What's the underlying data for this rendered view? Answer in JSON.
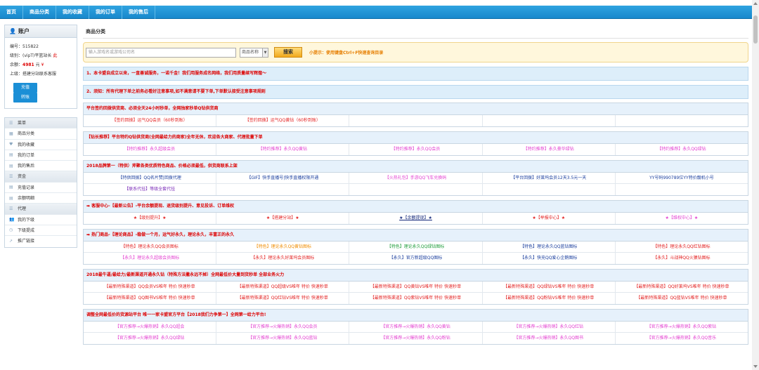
{
  "topnav": [
    "首页",
    "商品分类",
    "我的收藏",
    "我的订单",
    "我的售后"
  ],
  "account": {
    "title": "账户",
    "id_label": "编号：",
    "id": "515822",
    "level_label": "级别：",
    "level": "(vipT)平篮站长",
    "level_badge": "此",
    "balance_label": "余额：",
    "balance": "4981",
    "balance_unit": "元",
    "balance_icon": "¥",
    "parent_label": "上级：",
    "parent": "搭建分站联系客服",
    "recharge": "充值",
    "transfer": "转账"
  },
  "menu": [
    {
      "label": "菜单",
      "group": true
    },
    {
      "label": "商品分类",
      "group": false
    },
    {
      "label": "我的收藏",
      "group": false
    },
    {
      "label": "我的订单",
      "group": false
    },
    {
      "label": "我的售后",
      "group": false
    },
    {
      "label": "资金",
      "group": true
    },
    {
      "label": "充值记录",
      "group": false
    },
    {
      "label": "余额明细",
      "group": false
    },
    {
      "label": "代理",
      "group": true
    },
    {
      "label": "我的下级",
      "group": false
    },
    {
      "label": "下级提成",
      "group": false
    },
    {
      "label": "推广链接",
      "group": false
    }
  ],
  "main": {
    "title": "商品分类",
    "search_placeholder": "输入游戏名或游戏公司名",
    "search_select": "商品名称",
    "search_button": "搜索",
    "search_tip": "小提示：使用键盘Ctrl+F快速查询目录",
    "notice1": "1、本卡盟自成立以来，一直善诚服务，一诺千金！我们用服务成名网络，我们用质量续写辉煌～",
    "notice2": "2、须知：所有代理下单之前务必看好注意事项,如不满意请不要下单,下单默认接受注意事项规则"
  },
  "sections": [
    {
      "head": "平台签约回拨供货商、必须全天24小时秒单，全网独家秒单Q钻供货商",
      "rows": [
        [
          {
            "t": "【签约回拨】运气QQ会员（60秒到账）",
            "c": "c-red"
          },
          {
            "t": "【签约回拨】运气QQ黄钻（60秒到账）",
            "c": "c-red"
          },
          {
            "t": "",
            "c": ""
          },
          {
            "t": "",
            "c": ""
          },
          {
            "t": "",
            "c": ""
          }
        ]
      ]
    },
    {
      "head": "【钻长推荐】平台特约Q钻供货商(全网最给力的商家)全年无休，欢迎各大商家、代理批量下单",
      "rows": [
        [
          {
            "t": "【特约推荐】永久超级会员",
            "c": "c-pink"
          },
          {
            "t": "【特约推荐】永久QQ黄钻",
            "c": "c-pink"
          },
          {
            "t": "【特约推荐】永久QQ会员",
            "c": "c-pink"
          },
          {
            "t": "【特约推荐】永久豪华绿钻",
            "c": "c-pink"
          },
          {
            "t": "【特约推荐】永久QQ绿钻",
            "c": "c-pink"
          }
        ]
      ]
    },
    {
      "head": "2018品牌第一（特供）斧聚各类优质特色商品、价格必须最低，供货商联系上架",
      "rows": [
        [
          {
            "t": "【特供回拨】QQ名片赞|回拨代理",
            "c": "c-blue"
          },
          {
            "t": "【GIF】快手直播号|快手直播权限开通",
            "c": "c-blue"
          },
          {
            "t": "【火热礼包】手游QQ飞车兑换码",
            "c": "c-pink"
          },
          {
            "t": "【平台回拨】好莱坞会员12天3.5元一天",
            "c": "c-blue"
          },
          {
            "t": "YY号码990789位YY特价靓机小号",
            "c": "c-blue"
          }
        ],
        [
          {
            "t": "【联系代挂】等级全套代挂",
            "c": "c-purple"
          },
          {
            "t": "",
            "c": ""
          },
          {
            "t": "",
            "c": ""
          },
          {
            "t": "",
            "c": ""
          },
          {
            "t": "",
            "c": ""
          }
        ]
      ]
    },
    {
      "head": "➡ 客服中心-【最新公告】-平台余额提现、退货级别提升、意见投诉、订单维权",
      "rows": [
        [
          {
            "t": "★【级别提升】★",
            "c": "c-red"
          },
          {
            "t": "★【搭建分站】★",
            "c": "c-red"
          },
          {
            "t": "★【余额提现】★",
            "c": "c-navy u"
          },
          {
            "t": "★【举报中心】★",
            "c": "c-red"
          },
          {
            "t": "★【维权中心】★",
            "c": "c-pink"
          }
        ]
      ]
    },
    {
      "head": "➡ 热门商品-【理论商品】-稳做一个月，运气好永久，理论永久，丰富正的永久",
      "rows": [
        [
          {
            "t": "【特色】理论永久QQ会员图标",
            "c": "c-red"
          },
          {
            "t": "【特色】理论永久QQ黄钻图标",
            "c": "c-orange"
          },
          {
            "t": "【特色】理论永久QQ绿钻图标",
            "c": "c-green"
          },
          {
            "t": "【特色】理论永久QQ蓝钻图标",
            "c": "c-blue"
          },
          {
            "t": "【特色】理论永久QQ红钻图标",
            "c": "c-red"
          }
        ],
        [
          {
            "t": "【永久】理论永久超级会员图标",
            "c": "c-pink"
          },
          {
            "t": "【永久】理论永久好莱坞会员图标",
            "c": "c-red"
          },
          {
            "t": "【永久】官方新超级QQ图标",
            "c": "c-blue"
          },
          {
            "t": "【永久】快充QQ爱心企鹅图标",
            "c": "c-blue"
          },
          {
            "t": "【永久】斗战神QQ火猿钻图标",
            "c": "c-red"
          }
        ]
      ]
    },
    {
      "head": "2018最牛逼/最给力/最新渠道开通永久钻（特殊方法撇永远不掉）全网最低价大量到货秒单 全部业务火力",
      "rows": [
        [
          {
            "t": "【最新特殊渠道】QQ会员VS唯年 特价 快速秒单",
            "c": "c-red"
          },
          {
            "t": "【最新特殊渠道】QQ超级VS唯年 特价 快速秒单",
            "c": "c-red"
          },
          {
            "t": "【最新特殊渠道】QQ黄钻VS唯年 特价 快速秒单",
            "c": "c-red"
          },
          {
            "t": "【最新特殊渠道】QQ绿钻VS唯年 特价 快速秒单",
            "c": "c-red"
          },
          {
            "t": "【最新特殊渠道】QQ好莱坞VS唯年 特价 快速秒单",
            "c": "c-red"
          }
        ],
        [
          {
            "t": "【最新特殊渠道】QQ图书VS唯年 特价 快速秒单",
            "c": "c-red"
          },
          {
            "t": "【最新特殊渠道】QQ红钻VS唯年 特价 快速秒单",
            "c": "c-red"
          },
          {
            "t": "【最新特殊渠道】QQ紫钻VS唯年 特价 快速秒单",
            "c": "c-red"
          },
          {
            "t": "【最新特殊渠道】QQ粉钻VS唯年 特价 快速秒单",
            "c": "c-red"
          },
          {
            "t": "【最新特殊渠道】QQ蓝钻VS唯年 特价 快速秒单",
            "c": "c-red"
          }
        ]
      ]
    },
    {
      "head": "调整全网最低价的货源站平台 唯一一家卡盟官方平台【2018我们力争第一】全网第一给力平台!",
      "rows": [
        [
          {
            "t": "【官方推荐→火爆热销】永久QQ超会",
            "c": "c-pink"
          },
          {
            "t": "【官方推荐→火爆热销】永久QQ会员",
            "c": "c-pink"
          },
          {
            "t": "【官方推荐→火爆热销】永久QQ黄钻",
            "c": "c-pink"
          },
          {
            "t": "【官方推荐→火爆热销】永久QQ红钻",
            "c": "c-pink"
          },
          {
            "t": "【官方推荐→火爆热销】永久QQ紫钻",
            "c": "c-pink"
          }
        ],
        [
          {
            "t": "【官方推荐→火爆热销】永久QQ绿钻",
            "c": "c-pink"
          },
          {
            "t": "【官方推荐→火爆热销】永久QQ蓝钻",
            "c": "c-pink"
          },
          {
            "t": "【官方推荐→火爆热销】永久QQ粉钻",
            "c": "c-pink"
          },
          {
            "t": "【官方推荐→火爆热销】永久QQ图书",
            "c": "c-pink"
          },
          {
            "t": "【官方推荐→火爆热销】永久QQ音乐",
            "c": "c-pink"
          }
        ]
      ]
    }
  ]
}
